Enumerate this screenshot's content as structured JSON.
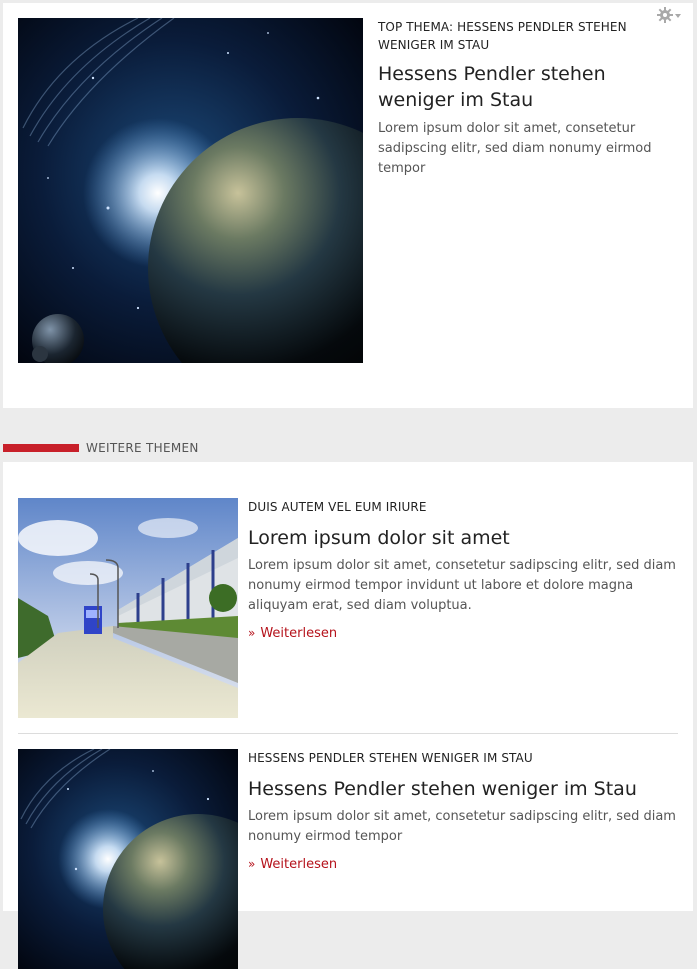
{
  "top_story": {
    "kicker": "TOP THEMA: HESSENS PENDLER STEHEN WENIGER IM STAU",
    "headline": "Hessens Pendler stehen weniger im Stau",
    "teaser": "Lorem ipsum dolor sit amet, consetetur sadipscing elitr, sed diam nonumy eirmod tempor",
    "image_icon": "planet-earth-space-image"
  },
  "settings": {
    "icon": "gear-icon"
  },
  "section": {
    "title": "WEITERE THEMEN",
    "accent": "#c8202a"
  },
  "articles": [
    {
      "kicker": "DUIS AUTEM VEL EUM IRIURE",
      "headline": "Lorem ipsum dolor sit amet",
      "teaser": "Lorem ipsum dolor sit amet, consetetur sadipscing elitr, sed diam nonumy eirmod tempor invidunt ut labore et dolore magna aliquyam erat, sed diam voluptua.",
      "readmore": "Weiterlesen",
      "image_icon": "industrial-building-road-image"
    },
    {
      "kicker": "HESSENS PENDLER STEHEN WENIGER IM STAU",
      "headline": "Hessens Pendler stehen weniger im Stau",
      "teaser": "Lorem ipsum dolor sit amet, consetetur sadipscing elitr, sed diam nonumy eirmod tempor",
      "readmore": "Weiterlesen",
      "image_icon": "planet-earth-space-image"
    }
  ],
  "colors": {
    "link": "#b5121b",
    "background": "#ececec",
    "card": "#ffffff"
  }
}
